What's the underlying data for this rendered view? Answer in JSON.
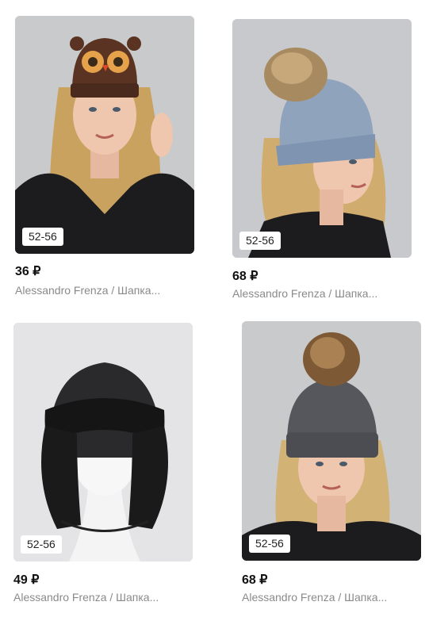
{
  "products": [
    {
      "size": "52-56",
      "price": "36 ₽",
      "title": "Alessandro Frenza / Шапка..."
    },
    {
      "size": "52-56",
      "price": "68 ₽",
      "title": "Alessandro Frenza / Шапка..."
    },
    {
      "size": "52-56",
      "price": "49 ₽",
      "title": "Alessandro Frenza / Шапка..."
    },
    {
      "size": "52-56",
      "price": "68 ₽",
      "title": "Alessandro Frenza / Шапка..."
    }
  ]
}
